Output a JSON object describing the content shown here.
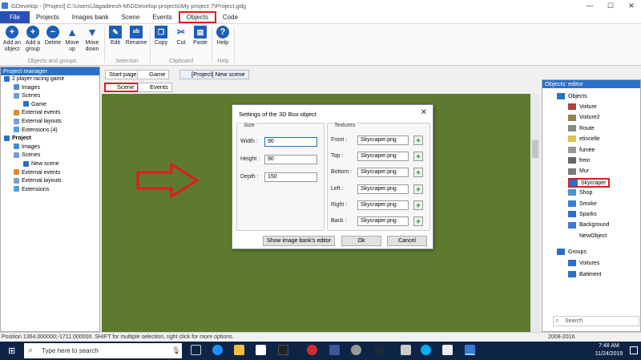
{
  "window": {
    "title": "GDevelop - [Project] C:\\Users\\Jagadeesh-M\\GDevelop projects\\My project 7\\Project.gdg",
    "minimize": "—",
    "maximize": "☐",
    "close": "✕"
  },
  "menu": [
    "File",
    "Projects",
    "Images bank",
    "Scene",
    "Events",
    "Objects",
    "Code"
  ],
  "ribbon": {
    "buttons": [
      {
        "label": "Add an object",
        "icon": "plus-icon",
        "color": "#1d5fb4"
      },
      {
        "label": "Add a group",
        "icon": "plus-icon",
        "color": "#1d5fb4"
      },
      {
        "label": "Delete",
        "icon": "minus-icon",
        "color": "#1d5fb4"
      },
      {
        "label": "Move up",
        "icon": "arrow-up-icon",
        "color": "#1d5fb4"
      },
      {
        "label": "Move down",
        "icon": "arrow-down-icon",
        "color": "#1d5fb4"
      },
      {
        "label": "Edit",
        "icon": "edit-icon",
        "color": "#1d5fb4"
      },
      {
        "label": "Rename",
        "icon": "rename-icon",
        "color": "#1d5fb4"
      },
      {
        "label": "Copy",
        "icon": "copy-icon",
        "color": "#1d5fb4"
      },
      {
        "label": "Cut",
        "icon": "scissors-icon",
        "color": "#1d5fb4"
      },
      {
        "label": "Paste",
        "icon": "paste-icon",
        "color": "#1d5fb4"
      },
      {
        "label": "Help",
        "icon": "help-icon",
        "color": "#1d5fb4"
      }
    ],
    "groups": [
      "Objects and groups",
      "Selection",
      "Clipboard",
      "Help"
    ]
  },
  "project_manager": {
    "title": "Project manager",
    "tree": [
      {
        "label": "2 player racing game",
        "level": 0,
        "bold": false,
        "icon": "game-icon"
      },
      {
        "label": "Images",
        "level": 1,
        "icon": "images-icon"
      },
      {
        "label": "Scenes",
        "level": 1,
        "icon": "scenes-icon"
      },
      {
        "label": "Game",
        "level": 2,
        "icon": "scene-icon"
      },
      {
        "label": "External events",
        "level": 1,
        "icon": "events-icon"
      },
      {
        "label": "External layouts",
        "level": 1,
        "icon": "layouts-icon"
      },
      {
        "label": "Extensions (4)",
        "level": 1,
        "icon": "extensions-icon"
      },
      {
        "label": "Project",
        "level": 0,
        "bold": true,
        "icon": "project-icon"
      },
      {
        "label": "Images",
        "level": 1,
        "icon": "images-icon"
      },
      {
        "label": "Scenes",
        "level": 1,
        "icon": "scenes-icon"
      },
      {
        "label": "New scene",
        "level": 2,
        "icon": "scene-icon"
      },
      {
        "label": "External events",
        "level": 1,
        "icon": "events-icon"
      },
      {
        "label": "External layouts",
        "level": 1,
        "icon": "layouts-icon"
      },
      {
        "label": "Extensions",
        "level": 1,
        "icon": "extensions-icon"
      }
    ]
  },
  "doc_tabs": [
    "Start page",
    "Game",
    "[Project] New scene"
  ],
  "sub_tabs": [
    "Scene",
    "Events"
  ],
  "dialog": {
    "title": "Settings of the 3D Box object",
    "size_legend": "Size",
    "textures_legend": "Textures",
    "size_fields": [
      {
        "label": "Width :",
        "value": "90"
      },
      {
        "label": "Height :",
        "value": "90"
      },
      {
        "label": "Depth :",
        "value": "150"
      }
    ],
    "texture_fields": [
      {
        "label": "Front :",
        "value": "Skycraper.png"
      },
      {
        "label": "Top :",
        "value": "Skycraper.png"
      },
      {
        "label": "Bottom :",
        "value": "Skycraper.png"
      },
      {
        "label": "Left :",
        "value": "Skycraper.png"
      },
      {
        "label": "Right :",
        "value": "Skycraper.png"
      },
      {
        "label": "Back :",
        "value": "Skycraper.png"
      }
    ],
    "show_editor": "Show image bank's editor",
    "ok": "Ok",
    "cancel": "Cancel"
  },
  "objects_editor": {
    "title": "Objects' editor",
    "objects_root": "Objects",
    "objects": [
      "Voiture",
      "Voiture2",
      "Route",
      "etincelle",
      "fumée",
      "frein",
      "Mur",
      "Skycraper",
      "Shop",
      "Smoke",
      "Sparks",
      "Background",
      "NewObject"
    ],
    "groups_root": "Groups",
    "groups": [
      "Voitures",
      "Batiment"
    ],
    "search_placeholder": "Search"
  },
  "status": {
    "text": "Position 1364.000000;-1711.000000. SHIFT for multiple selection, right click for more options.",
    "copyright": "2008-2016"
  },
  "taskbar": {
    "search": "Type here to search",
    "time": "7:48 AM",
    "date": "11/24/2019"
  },
  "colors": {
    "accent": "#2b70c8",
    "highlight": "#e21b1b",
    "scene": "#5e7a2e",
    "taskbar": "#0e2447"
  }
}
